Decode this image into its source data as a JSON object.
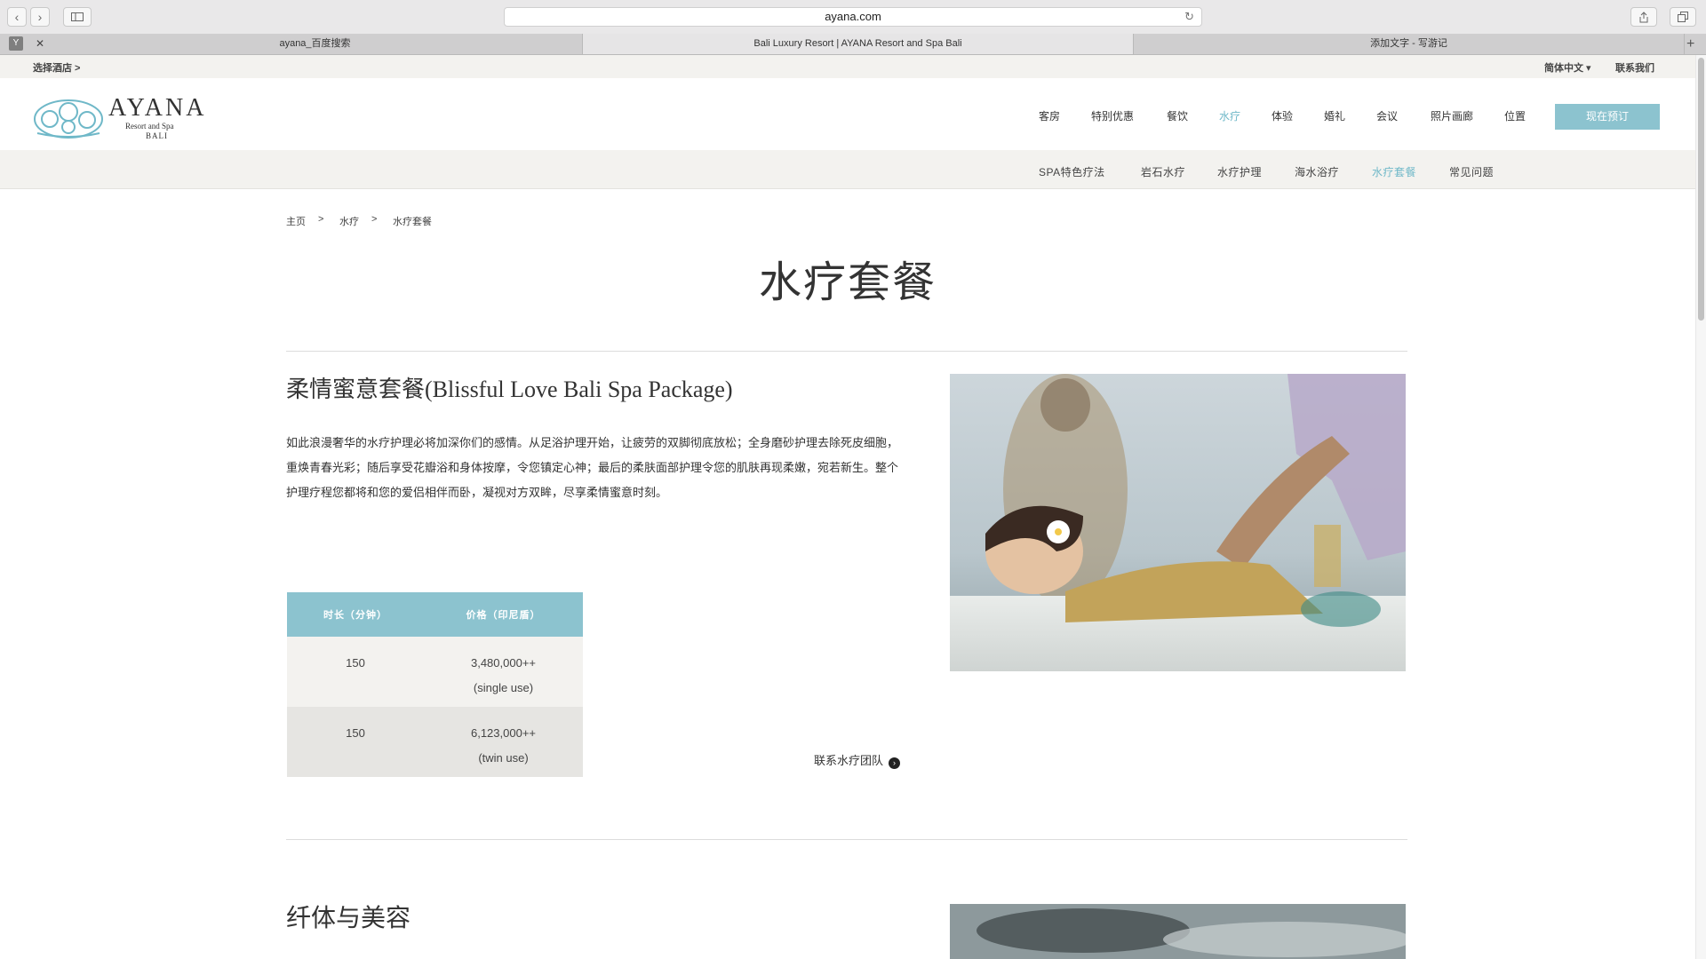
{
  "browser": {
    "url": "ayana.com",
    "tabs": [
      {
        "label": "ayana_百度搜索"
      },
      {
        "label": "Bali Luxury Resort | AYANA Resort and Spa Bali"
      },
      {
        "label": "添加文字 - 写游记"
      }
    ],
    "tab_icon": "Y"
  },
  "utility": {
    "select_hotel": "选择酒店 >",
    "language": "简体中文 ▾",
    "contact": "联系我们"
  },
  "logo": {
    "name": "AYANA",
    "subtitle": "Resort and Spa",
    "location": "BALI"
  },
  "nav": {
    "items": [
      "客房",
      "特别优惠",
      "餐饮",
      "水疗",
      "体验",
      "婚礼",
      "会议",
      "照片画廊",
      "位置"
    ],
    "active": "水疗",
    "book": "现在预订"
  },
  "subnav": {
    "items": [
      "SPA特色疗法",
      "岩石水疗",
      "水疗护理",
      "海水浴疗",
      "水疗套餐",
      "常见问题"
    ],
    "active": "水疗套餐"
  },
  "breadcrumb": {
    "items": [
      "主页",
      ">",
      "水疗",
      ">",
      "水疗套餐"
    ]
  },
  "page": {
    "title": "水疗套餐"
  },
  "package": {
    "title": "柔情蜜意套餐(Blissful Love Bali Spa Package)",
    "description": "如此浪漫奢华的水疗护理必将加深你们的感情。从足浴护理开始，让疲劳的双脚彻底放松；全身磨砂护理去除死皮细胞，重焕青春光彩；随后享受花瓣浴和身体按摩，令您镇定心神；最后的柔肤面部护理令您的肌肤再现柔嫩，宛若新生。整个护理疗程您都将和您的爱侣相伴而卧，凝视对方双眸，尽享柔情蜜意时刻。",
    "table": {
      "headers": [
        "时长（分钟）",
        "价格（印尼盾）"
      ],
      "rows": [
        {
          "duration": "150",
          "price": "3,480,000++",
          "note": "(single use)"
        },
        {
          "duration": "150",
          "price": "6,123,000++",
          "note": "(twin use)"
        }
      ]
    },
    "contact_link": "联系水疗团队"
  },
  "next_section": {
    "title": "纤体与美容"
  },
  "colors": {
    "accent": "#8cc3cf",
    "active_link": "#6fb8c8",
    "light_bg": "#f3f2ef"
  },
  "icons": {
    "back": "chevron-left-icon",
    "forward": "chevron-right-icon",
    "sidebar": "sidebar-icon",
    "reload": "reload-icon",
    "share": "share-icon",
    "tabs": "tabs-icon",
    "arrow": "arrow-circle-icon"
  }
}
